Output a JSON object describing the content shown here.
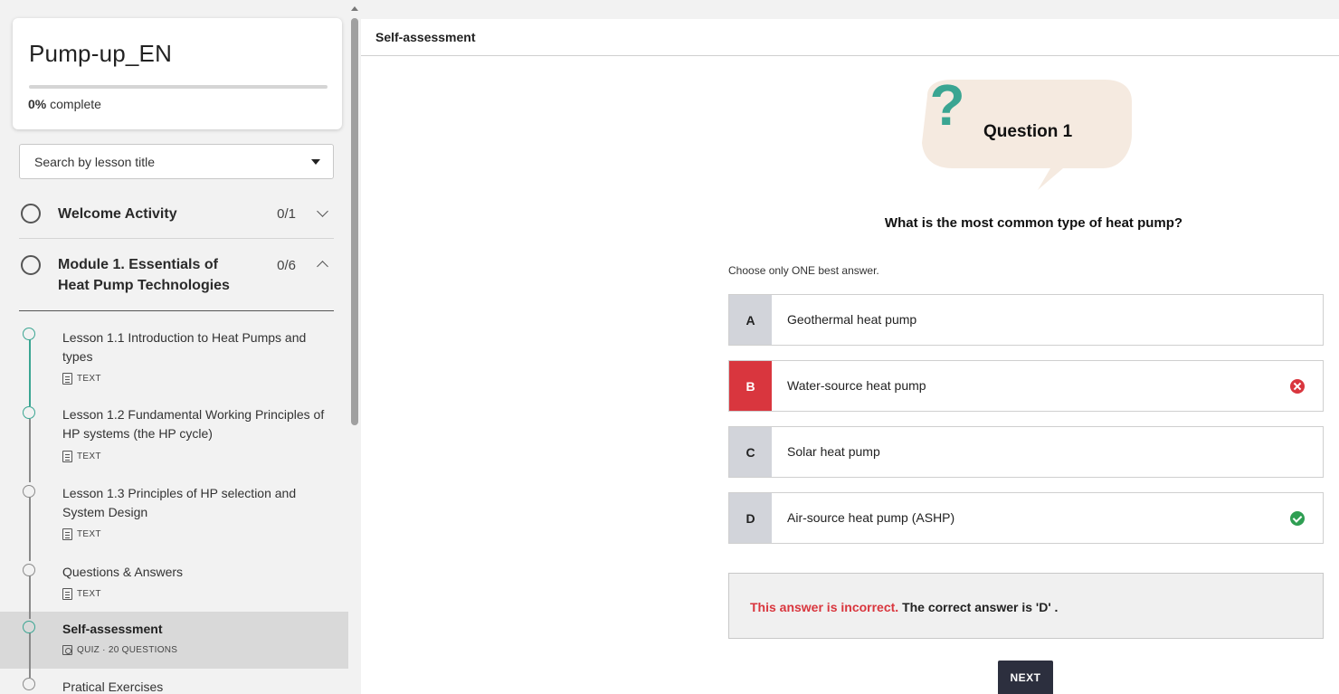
{
  "course": {
    "title": "Pump-up_EN",
    "progress_percent": 0,
    "progress_value": "0%",
    "progress_suffix": " complete"
  },
  "search": {
    "placeholder": "Search by lesson title"
  },
  "sections": [
    {
      "title": "Welcome Activity",
      "count": "0/1",
      "expanded": false
    },
    {
      "title": "Module 1. Essentials of Heat Pump Technologies",
      "count": "0/6",
      "expanded": true
    }
  ],
  "lessons": [
    {
      "title": "Lesson 1.1 Introduction to Heat Pumps and types",
      "type": "TEXT",
      "icon": "text-doc-icon"
    },
    {
      "title": "Lesson 1.2 Fundamental Working Principles of HP systems (the HP cycle)",
      "type": "TEXT",
      "icon": "text-doc-icon"
    },
    {
      "title": "Lesson 1.3 Principles of HP selection and System Design",
      "type": "TEXT",
      "icon": "text-doc-icon"
    },
    {
      "title": "Questions & Answers",
      "type": "TEXT",
      "icon": "text-doc-icon"
    },
    {
      "title": "Self-assessment",
      "type": "QUIZ · 20 QUESTIONS",
      "icon": "quiz-icon",
      "active": true
    },
    {
      "title": "Pratical Exercises",
      "type": "",
      "icon": ""
    }
  ],
  "main": {
    "title": "Self-assessment",
    "question_label": "Question 1",
    "question_text": "What is the most common type of heat pump?",
    "instruction": "Choose only ONE best answer.",
    "options": [
      {
        "letter": "A",
        "text": "Geothermal heat pump",
        "status": "none"
      },
      {
        "letter": "B",
        "text": "Water-source heat pump",
        "status": "incorrect"
      },
      {
        "letter": "C",
        "text": "Solar heat pump",
        "status": "none"
      },
      {
        "letter": "D",
        "text": "Air-source heat pump (ASHP)",
        "status": "correct"
      }
    ],
    "feedback": {
      "incorrect": "This answer is incorrect.",
      "correct": "The correct answer is 'D' ."
    },
    "next_label": "NEXT"
  },
  "colors": {
    "accent_teal": "#3aa592",
    "error_red": "#d9363e",
    "success_green": "#2e9e52",
    "bubble_beige": "#f5eae0",
    "question_mark_teal": "#3aa592",
    "button_dark": "#2c2f3e"
  }
}
